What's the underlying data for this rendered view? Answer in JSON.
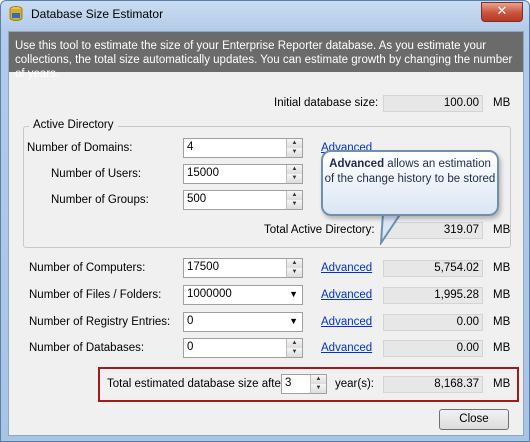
{
  "window": {
    "title": "Database Size Estimator",
    "close_glyph": "✕"
  },
  "banner": {
    "text": "Use this tool to estimate the size of your Enterprise Reporter database. As you estimate your collections, the total size automatically updates. You can estimate growth by changing the number of years."
  },
  "initial": {
    "label": "Initial database size:",
    "value": "100.00",
    "unit": "MB"
  },
  "active_directory": {
    "title": "Active Directory",
    "domains": {
      "label": "Number of Domains:",
      "value": "4",
      "advanced": "Advanced"
    },
    "users": {
      "label": "Number of Users:",
      "value": "15000"
    },
    "groups": {
      "label": "Number of Groups:",
      "value": "500"
    },
    "total": {
      "label": "Total Active Directory:",
      "value": "319.07",
      "unit": "MB"
    }
  },
  "callout": {
    "bold": "Advanced",
    "rest": " allows an estimation of the change history to be stored"
  },
  "computers": {
    "label": "Number of Computers:",
    "value": "17500",
    "advanced": "Advanced",
    "size": "5,754.02",
    "unit": "MB"
  },
  "files": {
    "label": "Number of Files / Folders:",
    "value": "1000000",
    "advanced": "Advanced",
    "size": "1,995.28",
    "unit": "MB"
  },
  "registry": {
    "label": "Number of Registry Entries:",
    "value": "0",
    "advanced": "Advanced",
    "size": "0.00",
    "unit": "MB"
  },
  "databases": {
    "label": "Number of Databases:",
    "value": "0",
    "advanced": "Advanced",
    "size": "0.00",
    "unit": "MB"
  },
  "total": {
    "label": "Total estimated database size after",
    "years": "3",
    "years_label": "year(s):",
    "value": "8,168.37",
    "unit": "MB"
  },
  "close_button": "Close",
  "icons": {
    "up": "▲",
    "down": "▼"
  },
  "colors": {
    "link": "#0033cc",
    "highlight": "#a01c1c",
    "banner": "#6b6b6b"
  }
}
